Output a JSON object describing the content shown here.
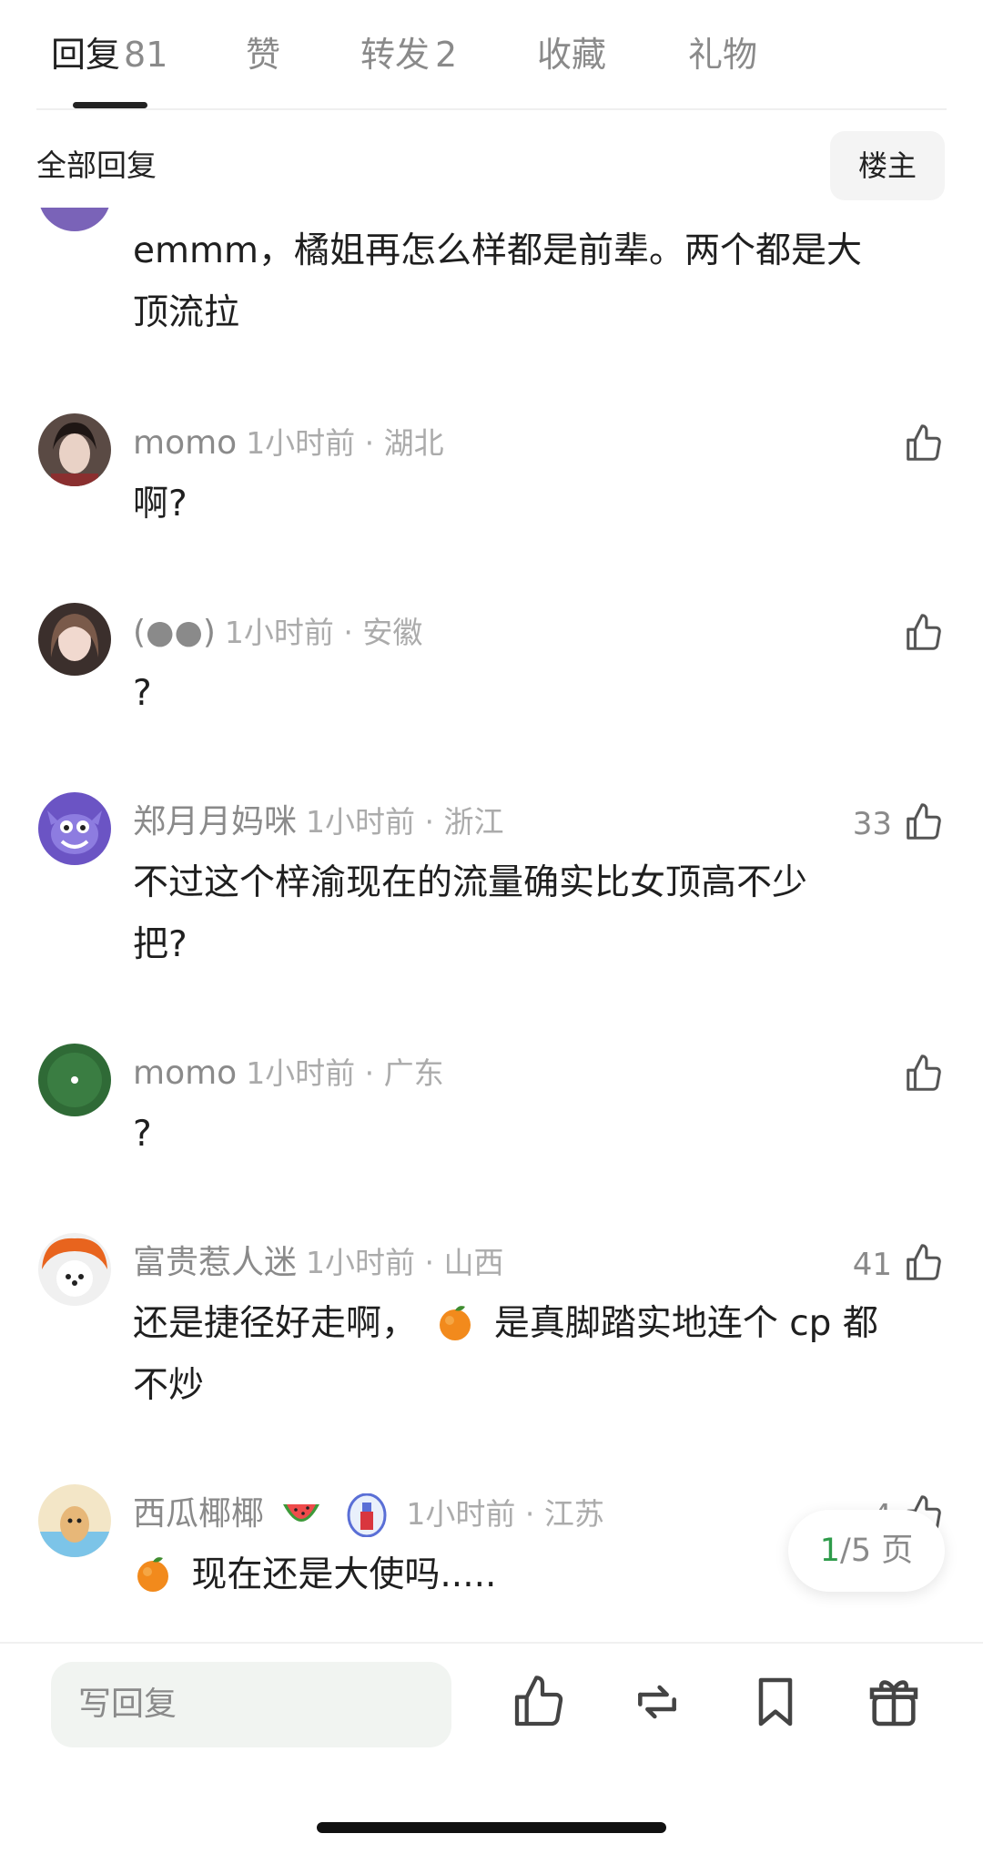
{
  "tabs": [
    {
      "label": "回复",
      "count": "81"
    },
    {
      "label": "赞",
      "count": ""
    },
    {
      "label": "转发",
      "count": "2"
    },
    {
      "label": "收藏",
      "count": ""
    },
    {
      "label": "礼物",
      "count": ""
    }
  ],
  "filter": {
    "label": "全部回复",
    "button": "楼主"
  },
  "top_comment": {
    "line1": "emmm，橘姐再怎么样都是前辈。两个都是大",
    "line2": "顶流拉"
  },
  "comments": [
    {
      "user": "momo",
      "time": "1小时前 · 湖北",
      "likes": "",
      "text": "啊?"
    },
    {
      "user": "(●●)",
      "time": "1小时前 · 安徽",
      "likes": "",
      "text": "?"
    },
    {
      "user": "郑月月妈咪",
      "time": "1小时前 · 浙江",
      "likes": "33",
      "line1": "不过这个梓渝现在的流量确实比女顶高不少",
      "line2": "把?"
    },
    {
      "user": "momo",
      "time": "1小时前 · 广东",
      "likes": "",
      "text": "?"
    },
    {
      "user": "富贵惹人迷",
      "time": "1小时前 · 山西",
      "likes": "41",
      "line1a": "还是捷径好走啊，",
      "line1b": "是真脚踏实地连个 cp 都",
      "line2": "不炒"
    },
    {
      "user": "西瓜椰椰",
      "time": "1小时前 · 江苏",
      "likes": "4",
      "text": "现在还是大使吗....."
    }
  ],
  "pager": {
    "current": "1",
    "rest": "/5 页"
  },
  "bottom": {
    "reply_placeholder": "写回复"
  },
  "icons": [
    "thumbs-up-icon",
    "repost-icon",
    "bookmark-icon",
    "gift-icon"
  ],
  "colors": {
    "accent_green": "#2e9b4a",
    "text": "#222222",
    "muted": "#8a8a8a"
  }
}
